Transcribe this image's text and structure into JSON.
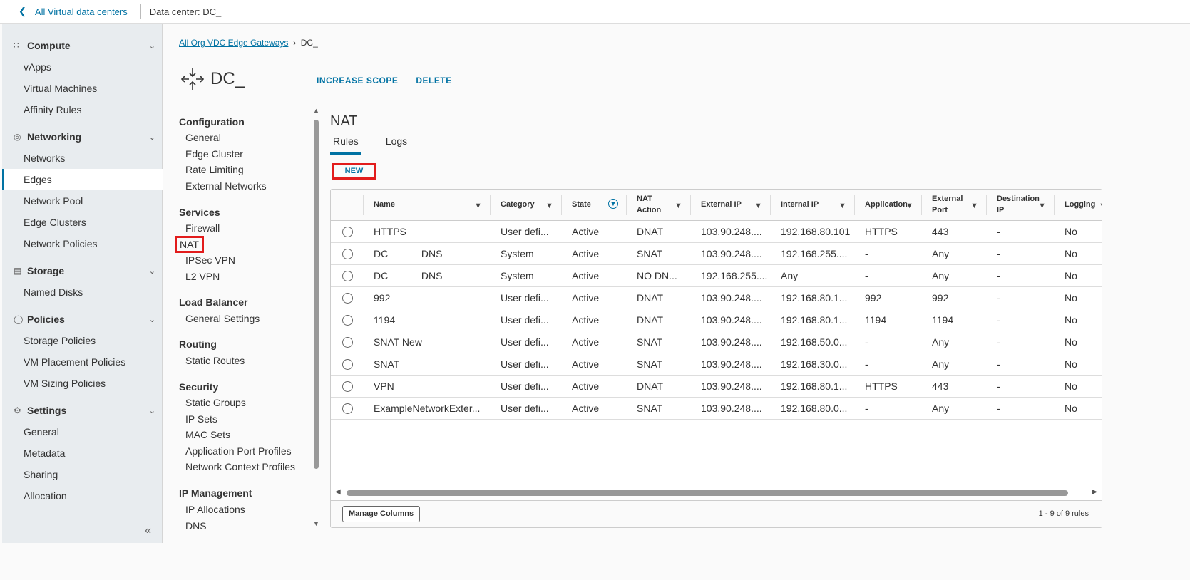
{
  "topbar": {
    "back_label": "All Virtual data centers",
    "datacenter_label": "Data center:",
    "datacenter_value": "DC_"
  },
  "sidebar": {
    "groups": [
      {
        "label": "Compute",
        "items": [
          "vApps",
          "Virtual Machines",
          "Affinity Rules"
        ]
      },
      {
        "label": "Networking",
        "items": [
          "Networks",
          "Edges",
          "Network Pool",
          "Edge Clusters",
          "Network Policies"
        ]
      },
      {
        "label": "Storage",
        "items": [
          "Named Disks"
        ]
      },
      {
        "label": "Policies",
        "items": [
          "Storage Policies",
          "VM Placement Policies",
          "VM Sizing Policies"
        ]
      },
      {
        "label": "Settings",
        "items": [
          "General",
          "Metadata",
          "Sharing",
          "Allocation"
        ]
      }
    ],
    "selected": "Edges"
  },
  "breadcrumb": {
    "parent": "All Org VDC Edge Gateways",
    "current": "DC_"
  },
  "header": {
    "title": "DC_",
    "actions": [
      "INCREASE SCOPE",
      "DELETE"
    ]
  },
  "nav": {
    "sections": [
      {
        "label": "Configuration",
        "items": [
          "General",
          "Edge Cluster",
          "Rate Limiting",
          "External Networks"
        ]
      },
      {
        "label": "Services",
        "items": [
          "Firewall",
          "NAT",
          "IPSec VPN",
          "L2 VPN"
        ]
      },
      {
        "label": "Load Balancer",
        "items": [
          "General Settings"
        ]
      },
      {
        "label": "Routing",
        "items": [
          "Static Routes"
        ]
      },
      {
        "label": "Security",
        "items": [
          "Static Groups",
          "IP Sets",
          "MAC Sets",
          "Application Port Profiles",
          "Network Context Profiles"
        ]
      },
      {
        "label": "IP Management",
        "items": [
          "IP Allocations",
          "DNS"
        ]
      }
    ],
    "selected": "NAT"
  },
  "panel": {
    "title": "NAT",
    "tabs": [
      "Rules",
      "Logs"
    ],
    "active_tab": "Rules",
    "new_label": "NEW",
    "columns": [
      "Name",
      "Category",
      "State",
      "NAT Action",
      "External IP",
      "Internal IP",
      "Application",
      "External Port",
      "Destination IP",
      "Logging"
    ],
    "rows": [
      [
        "HTTPS",
        "User defi...",
        "Active",
        "DNAT",
        "103.90.248....",
        "192.168.80.101",
        "HTTPS",
        "443",
        "-",
        "No"
      ],
      [
        "DC_          DNS",
        "System",
        "Active",
        "SNAT",
        "103.90.248....",
        "192.168.255....",
        "-",
        "Any",
        "-",
        "No"
      ],
      [
        "DC_          DNS",
        "System",
        "Active",
        "NO DN...",
        "192.168.255....",
        "Any",
        "-",
        "Any",
        "-",
        "No"
      ],
      [
        "992",
        "User defi...",
        "Active",
        "DNAT",
        "103.90.248....",
        "192.168.80.1...",
        "992",
        "992",
        "-",
        "No"
      ],
      [
        "1194",
        "User defi...",
        "Active",
        "DNAT",
        "103.90.248....",
        "192.168.80.1...",
        "1194",
        "1194",
        "-",
        "No"
      ],
      [
        "SNAT New",
        "User defi...",
        "Active",
        "SNAT",
        "103.90.248....",
        "192.168.50.0...",
        "-",
        "Any",
        "-",
        "No"
      ],
      [
        "SNAT",
        "User defi...",
        "Active",
        "SNAT",
        "103.90.248....",
        "192.168.30.0...",
        "-",
        "Any",
        "-",
        "No"
      ],
      [
        "VPN",
        "User defi...",
        "Active",
        "DNAT",
        "103.90.248....",
        "192.168.80.1...",
        "HTTPS",
        "443",
        "-",
        "No"
      ],
      [
        "ExampleNetworkExter...",
        "User defi...",
        "Active",
        "SNAT",
        "103.90.248....",
        "192.168.80.0...",
        "-",
        "Any",
        "-",
        "No"
      ]
    ],
    "manage_columns": "Manage Columns",
    "count": "1 - 9 of 9 rules"
  }
}
